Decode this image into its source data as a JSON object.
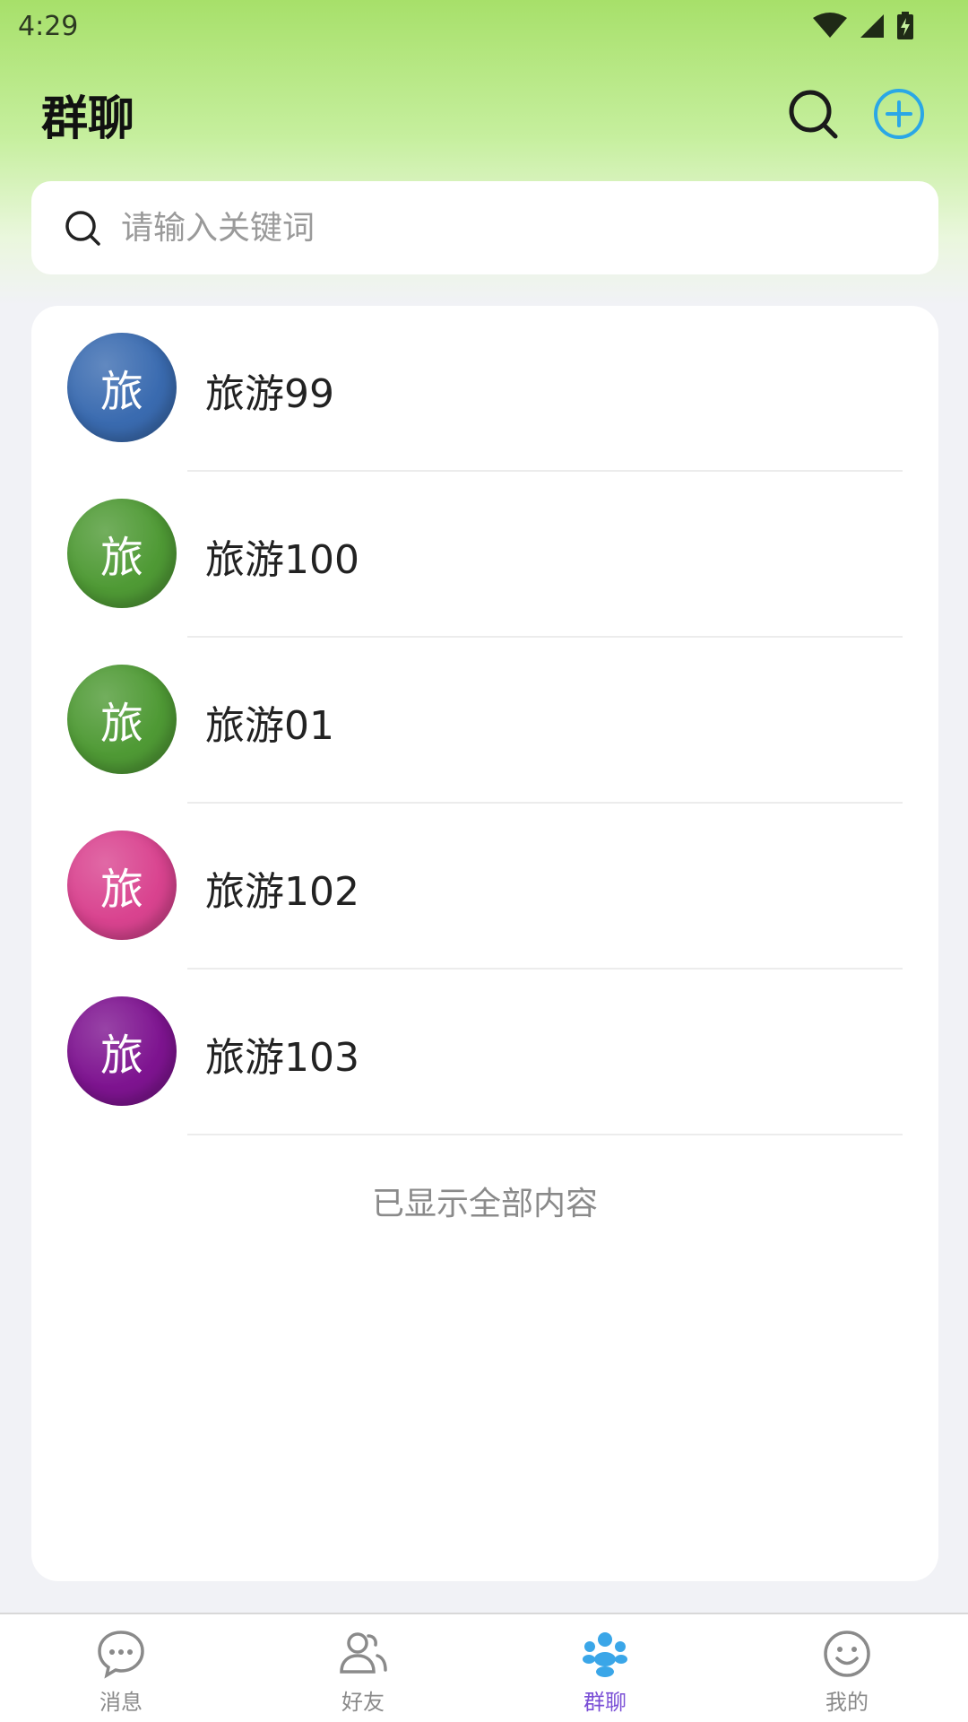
{
  "status_bar": {
    "time": "4:29"
  },
  "header": {
    "title": "群聊"
  },
  "search": {
    "placeholder": "请输入关键词"
  },
  "groups": [
    {
      "avatar_char": "旅",
      "name": "旅游99",
      "avatar_color": "#3a6bb0"
    },
    {
      "avatar_char": "旅",
      "name": "旅游100",
      "avatar_color": "#4f9a35"
    },
    {
      "avatar_char": "旅",
      "name": "旅游01",
      "avatar_color": "#4f9a35"
    },
    {
      "avatar_char": "旅",
      "name": "旅游102",
      "avatar_color": "#d9438f"
    },
    {
      "avatar_char": "旅",
      "name": "旅游103",
      "avatar_color": "#7e1490"
    }
  ],
  "list_footer": "已显示全部内容",
  "tabs": [
    {
      "label": "消息",
      "icon": "chat-bubble-icon",
      "active": false
    },
    {
      "label": "好友",
      "icon": "friends-icon",
      "active": false
    },
    {
      "label": "群聊",
      "icon": "group-icon",
      "active": true
    },
    {
      "label": "我的",
      "icon": "smiley-icon",
      "active": false
    }
  ],
  "colors": {
    "accent_add": "#2aa7e6",
    "active_tab": "#7a4fd6",
    "active_tab_icon": "#3aa6e8",
    "header_gradient_top": "#a7e06a"
  }
}
